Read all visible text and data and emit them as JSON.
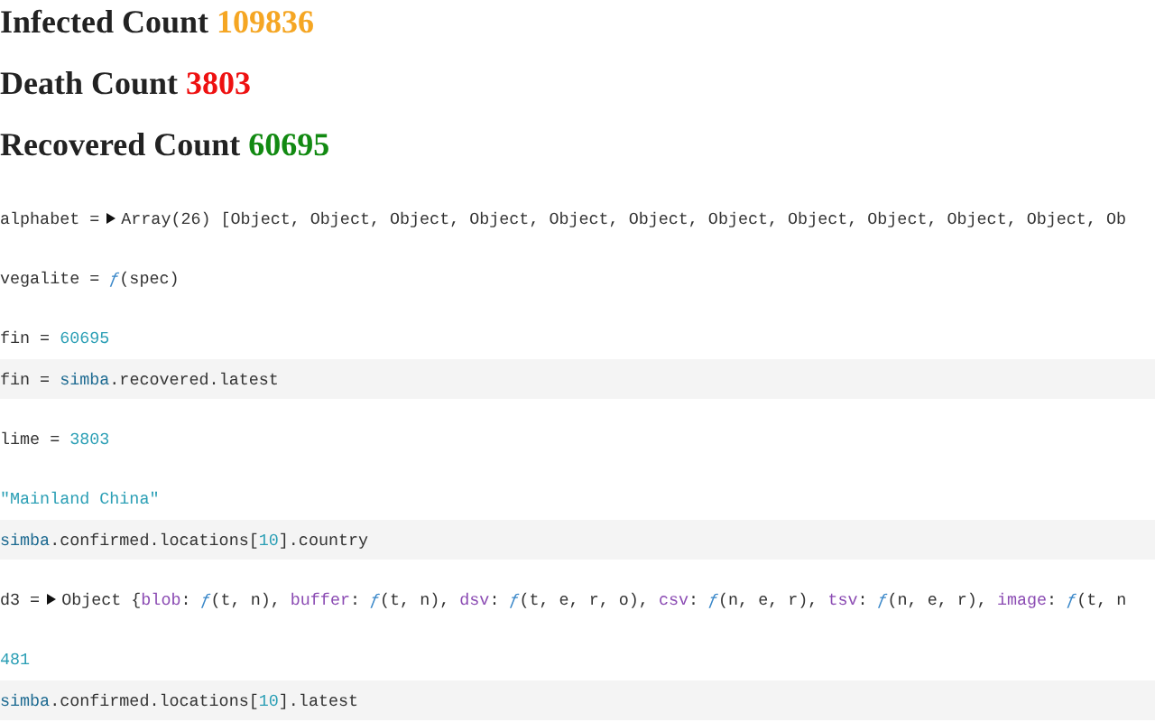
{
  "headings": [
    {
      "label": "Infected Count",
      "value": "109836",
      "color": "#f5a623"
    },
    {
      "label": "Death Count",
      "value": "3803",
      "color": "#ee1111"
    },
    {
      "label": "Recovered Count",
      "value": "60695",
      "color": "#128a12"
    }
  ],
  "cells": [
    {
      "output": [
        {
          "kind": "plain",
          "text": "alphabet ="
        },
        {
          "kind": "toggle",
          "expanded": false
        },
        {
          "kind": "plain",
          "text": "Array(26) [Object, Object, Object, Object, Object, Object, Object, Object, Object, Object, Object, Ob"
        }
      ]
    },
    {
      "output": [
        {
          "kind": "plain",
          "text": "vegalite = "
        },
        {
          "kind": "function",
          "text": "ƒ"
        },
        {
          "kind": "plain",
          "text": "(spec)"
        }
      ]
    },
    {
      "output": [
        {
          "kind": "plain",
          "text": "fin = "
        },
        {
          "kind": "number",
          "text": "60695"
        }
      ],
      "source": [
        {
          "kind": "name",
          "text": "fin = "
        },
        {
          "kind": "variable",
          "text": "simba"
        },
        {
          "kind": "plain",
          "text": ".recovered.latest"
        }
      ]
    },
    {
      "output": [
        {
          "kind": "plain",
          "text": "lime = "
        },
        {
          "kind": "number",
          "text": "3803"
        }
      ]
    },
    {
      "output": [
        {
          "kind": "string",
          "text": "\"Mainland China\""
        }
      ],
      "source": [
        {
          "kind": "variable",
          "text": "simba"
        },
        {
          "kind": "plain",
          "text": ".confirmed.locations["
        },
        {
          "kind": "number",
          "text": "10"
        },
        {
          "kind": "plain",
          "text": "].country"
        }
      ]
    },
    {
      "output": [
        {
          "kind": "plain",
          "text": "d3 ="
        },
        {
          "kind": "toggle",
          "expanded": false
        },
        {
          "kind": "plain",
          "text": "Object {"
        },
        {
          "kind": "key",
          "text": "blob"
        },
        {
          "kind": "plain",
          "text": ": "
        },
        {
          "kind": "function",
          "text": "ƒ"
        },
        {
          "kind": "plain",
          "text": "(t, n), "
        },
        {
          "kind": "key",
          "text": "buffer"
        },
        {
          "kind": "plain",
          "text": ": "
        },
        {
          "kind": "function",
          "text": "ƒ"
        },
        {
          "kind": "plain",
          "text": "(t, n), "
        },
        {
          "kind": "key",
          "text": "dsv"
        },
        {
          "kind": "plain",
          "text": ": "
        },
        {
          "kind": "function",
          "text": "ƒ"
        },
        {
          "kind": "plain",
          "text": "(t, e, r, o), "
        },
        {
          "kind": "key",
          "text": "csv"
        },
        {
          "kind": "plain",
          "text": ": "
        },
        {
          "kind": "function",
          "text": "ƒ"
        },
        {
          "kind": "plain",
          "text": "(n, e, r), "
        },
        {
          "kind": "key",
          "text": "tsv"
        },
        {
          "kind": "plain",
          "text": ": "
        },
        {
          "kind": "function",
          "text": "ƒ"
        },
        {
          "kind": "plain",
          "text": "(n, e, r), "
        },
        {
          "kind": "key",
          "text": "image"
        },
        {
          "kind": "plain",
          "text": ": "
        },
        {
          "kind": "function",
          "text": "ƒ"
        },
        {
          "kind": "plain",
          "text": "(t, n"
        }
      ]
    },
    {
      "output": [
        {
          "kind": "number",
          "text": "481"
        }
      ],
      "source": [
        {
          "kind": "variable",
          "text": "simba"
        },
        {
          "kind": "plain",
          "text": ".confirmed.locations["
        },
        {
          "kind": "number",
          "text": "10"
        },
        {
          "kind": "plain",
          "text": "].latest"
        }
      ]
    }
  ]
}
